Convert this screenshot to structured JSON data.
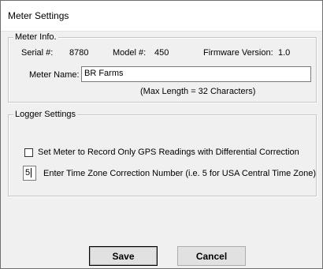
{
  "window": {
    "title": "Meter Settings"
  },
  "meter_info": {
    "group_label": "Meter Info.",
    "serial_label": "Serial #:",
    "serial_value": "8780",
    "model_label": "Model #:",
    "model_value": "450",
    "firmware_label": "Firmware Version:",
    "firmware_value": "1.0",
    "name_label": "Meter Name:",
    "name_value": "BR Farms",
    "max_length_note": "(Max Length = 32 Characters)"
  },
  "logger_settings": {
    "group_label": "Logger Settings",
    "gps_checkbox_label": "Set Meter to Record Only GPS Readings with Differential Correction",
    "gps_checked": false,
    "timezone_value": "5",
    "timezone_label": "Enter Time Zone Correction Number (i.e. 5 for USA Central Time Zone)"
  },
  "buttons": {
    "save_label": "Save",
    "cancel_label": "Cancel"
  }
}
